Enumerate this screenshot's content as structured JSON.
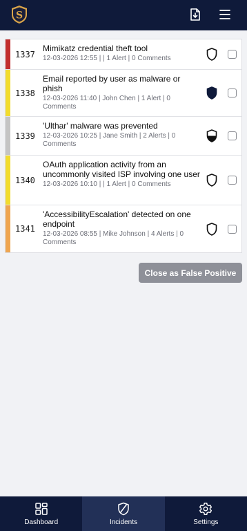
{
  "header": {
    "logo_letter": "S",
    "icons": [
      "file-download-icon",
      "hamburger-menu-icon"
    ]
  },
  "incidents": [
    {
      "id": "1337",
      "title": "Mimikatz credential theft tool",
      "meta": "12-03-2026 12:55 | | 1 Alert | 0 Comments",
      "severity_color": "#c22e2e",
      "status_icon": "shield-outline-icon"
    },
    {
      "id": "1338",
      "title": "Email reported by user as malware or phish",
      "meta": "12-03-2026 11:40 | John Chen | 1 Alert | 0 Comments",
      "severity_color": "#f2dc2e",
      "status_icon": "shield-filled-icon"
    },
    {
      "id": "1339",
      "title": "'Ulthar' malware was prevented",
      "meta": "12-03-2026 10:25 | Jane Smith | 2 Alerts | 0 Comments",
      "severity_color": "#c4c4c4",
      "status_icon": "shield-half-icon"
    },
    {
      "id": "1340",
      "title": "OAuth application activity from an uncommonly visited ISP involving one user",
      "meta": "12-03-2026 10:10 | | 1 Alert | 0 Comments",
      "severity_color": "#f2dc2e",
      "status_icon": "shield-outline-icon"
    },
    {
      "id": "1341",
      "title": "'AccessibilityEscalation' detected on one endpoint",
      "meta": "12-03-2026 08:55 | Mike Johnson | 4 Alerts | 0 Comments",
      "severity_color": "#efa54f",
      "status_icon": "shield-outline-icon"
    }
  ],
  "actions": {
    "close_false_positive": "Close as False Positive"
  },
  "bottom_nav": [
    {
      "label": "Dashboard",
      "icon": "dashboard-grid-icon",
      "active": false
    },
    {
      "label": "Incidents",
      "icon": "shield-icon",
      "active": true
    },
    {
      "label": "Settings",
      "icon": "gear-icon",
      "active": false
    }
  ],
  "colors": {
    "nav_bg": "#0f1a3a",
    "nav_active_bg": "#223057",
    "button_bg": "#8e9098",
    "logo_gold": "#d9a44a"
  }
}
